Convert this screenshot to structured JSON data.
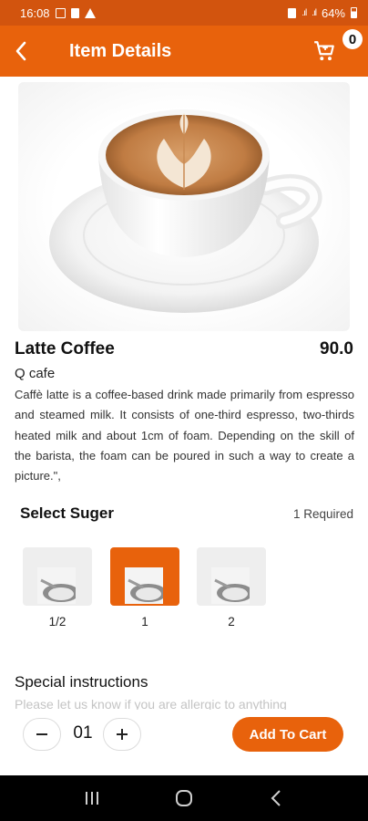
{
  "status_bar": {
    "time": "16:08",
    "battery": "64%"
  },
  "app_bar": {
    "title": "Item Details",
    "cart_count": "0",
    "icons": {
      "back": "chevron-left-icon",
      "cart": "shopping-cart-icon"
    }
  },
  "product": {
    "name": "Latte Coffee",
    "price": "90.0",
    "cafe": "Q cafe",
    "description": "Caffè latte is a coffee-based drink made primarily from espresso and steamed milk. It consists of one-third espresso, two-thirds heated milk and about 1cm of foam. Depending on the skill of the barista, the foam can be poured in such a way to create a picture.\","
  },
  "sugar": {
    "title": "Select Suger",
    "required": "1 Required",
    "options": [
      {
        "label": "1/2",
        "selected": false
      },
      {
        "label": "1",
        "selected": true
      },
      {
        "label": "2",
        "selected": false
      }
    ]
  },
  "special": {
    "title": "Special instructions",
    "placeholder": "Please let us know if you are allergic to anything"
  },
  "quantity": {
    "value": "01"
  },
  "actions": {
    "add_to_cart": "Add To Cart"
  },
  "colors": {
    "accent": "#e8620c",
    "status_bar": "#d2540e"
  }
}
